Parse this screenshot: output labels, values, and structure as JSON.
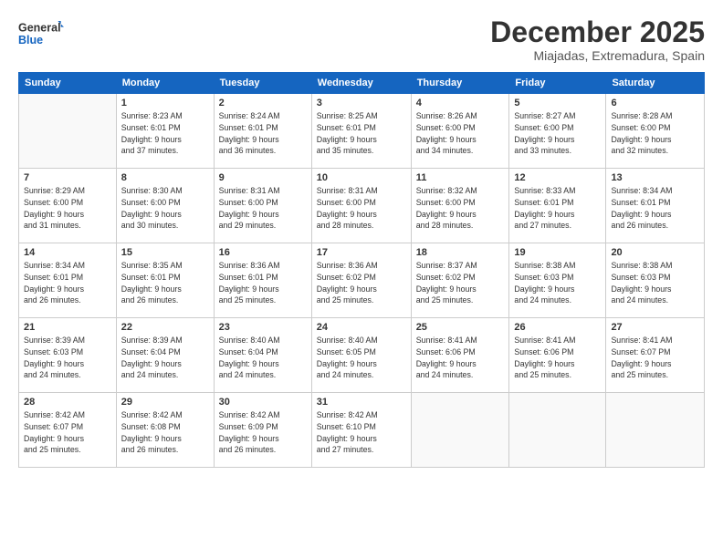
{
  "header": {
    "logo_line1": "General",
    "logo_line2": "Blue",
    "month": "December 2025",
    "location": "Miajadas, Extremadura, Spain"
  },
  "days_of_week": [
    "Sunday",
    "Monday",
    "Tuesday",
    "Wednesday",
    "Thursday",
    "Friday",
    "Saturday"
  ],
  "weeks": [
    [
      {
        "day": "",
        "info": ""
      },
      {
        "day": "1",
        "info": "Sunrise: 8:23 AM\nSunset: 6:01 PM\nDaylight: 9 hours\nand 37 minutes."
      },
      {
        "day": "2",
        "info": "Sunrise: 8:24 AM\nSunset: 6:01 PM\nDaylight: 9 hours\nand 36 minutes."
      },
      {
        "day": "3",
        "info": "Sunrise: 8:25 AM\nSunset: 6:01 PM\nDaylight: 9 hours\nand 35 minutes."
      },
      {
        "day": "4",
        "info": "Sunrise: 8:26 AM\nSunset: 6:00 PM\nDaylight: 9 hours\nand 34 minutes."
      },
      {
        "day": "5",
        "info": "Sunrise: 8:27 AM\nSunset: 6:00 PM\nDaylight: 9 hours\nand 33 minutes."
      },
      {
        "day": "6",
        "info": "Sunrise: 8:28 AM\nSunset: 6:00 PM\nDaylight: 9 hours\nand 32 minutes."
      }
    ],
    [
      {
        "day": "7",
        "info": "Sunrise: 8:29 AM\nSunset: 6:00 PM\nDaylight: 9 hours\nand 31 minutes."
      },
      {
        "day": "8",
        "info": "Sunrise: 8:30 AM\nSunset: 6:00 PM\nDaylight: 9 hours\nand 30 minutes."
      },
      {
        "day": "9",
        "info": "Sunrise: 8:31 AM\nSunset: 6:00 PM\nDaylight: 9 hours\nand 29 minutes."
      },
      {
        "day": "10",
        "info": "Sunrise: 8:31 AM\nSunset: 6:00 PM\nDaylight: 9 hours\nand 28 minutes."
      },
      {
        "day": "11",
        "info": "Sunrise: 8:32 AM\nSunset: 6:00 PM\nDaylight: 9 hours\nand 28 minutes."
      },
      {
        "day": "12",
        "info": "Sunrise: 8:33 AM\nSunset: 6:01 PM\nDaylight: 9 hours\nand 27 minutes."
      },
      {
        "day": "13",
        "info": "Sunrise: 8:34 AM\nSunset: 6:01 PM\nDaylight: 9 hours\nand 26 minutes."
      }
    ],
    [
      {
        "day": "14",
        "info": "Sunrise: 8:34 AM\nSunset: 6:01 PM\nDaylight: 9 hours\nand 26 minutes."
      },
      {
        "day": "15",
        "info": "Sunrise: 8:35 AM\nSunset: 6:01 PM\nDaylight: 9 hours\nand 26 minutes."
      },
      {
        "day": "16",
        "info": "Sunrise: 8:36 AM\nSunset: 6:01 PM\nDaylight: 9 hours\nand 25 minutes."
      },
      {
        "day": "17",
        "info": "Sunrise: 8:36 AM\nSunset: 6:02 PM\nDaylight: 9 hours\nand 25 minutes."
      },
      {
        "day": "18",
        "info": "Sunrise: 8:37 AM\nSunset: 6:02 PM\nDaylight: 9 hours\nand 25 minutes."
      },
      {
        "day": "19",
        "info": "Sunrise: 8:38 AM\nSunset: 6:03 PM\nDaylight: 9 hours\nand 24 minutes."
      },
      {
        "day": "20",
        "info": "Sunrise: 8:38 AM\nSunset: 6:03 PM\nDaylight: 9 hours\nand 24 minutes."
      }
    ],
    [
      {
        "day": "21",
        "info": "Sunrise: 8:39 AM\nSunset: 6:03 PM\nDaylight: 9 hours\nand 24 minutes."
      },
      {
        "day": "22",
        "info": "Sunrise: 8:39 AM\nSunset: 6:04 PM\nDaylight: 9 hours\nand 24 minutes."
      },
      {
        "day": "23",
        "info": "Sunrise: 8:40 AM\nSunset: 6:04 PM\nDaylight: 9 hours\nand 24 minutes."
      },
      {
        "day": "24",
        "info": "Sunrise: 8:40 AM\nSunset: 6:05 PM\nDaylight: 9 hours\nand 24 minutes."
      },
      {
        "day": "25",
        "info": "Sunrise: 8:41 AM\nSunset: 6:06 PM\nDaylight: 9 hours\nand 24 minutes."
      },
      {
        "day": "26",
        "info": "Sunrise: 8:41 AM\nSunset: 6:06 PM\nDaylight: 9 hours\nand 25 minutes."
      },
      {
        "day": "27",
        "info": "Sunrise: 8:41 AM\nSunset: 6:07 PM\nDaylight: 9 hours\nand 25 minutes."
      }
    ],
    [
      {
        "day": "28",
        "info": "Sunrise: 8:42 AM\nSunset: 6:07 PM\nDaylight: 9 hours\nand 25 minutes."
      },
      {
        "day": "29",
        "info": "Sunrise: 8:42 AM\nSunset: 6:08 PM\nDaylight: 9 hours\nand 26 minutes."
      },
      {
        "day": "30",
        "info": "Sunrise: 8:42 AM\nSunset: 6:09 PM\nDaylight: 9 hours\nand 26 minutes."
      },
      {
        "day": "31",
        "info": "Sunrise: 8:42 AM\nSunset: 6:10 PM\nDaylight: 9 hours\nand 27 minutes."
      },
      {
        "day": "",
        "info": ""
      },
      {
        "day": "",
        "info": ""
      },
      {
        "day": "",
        "info": ""
      }
    ]
  ]
}
